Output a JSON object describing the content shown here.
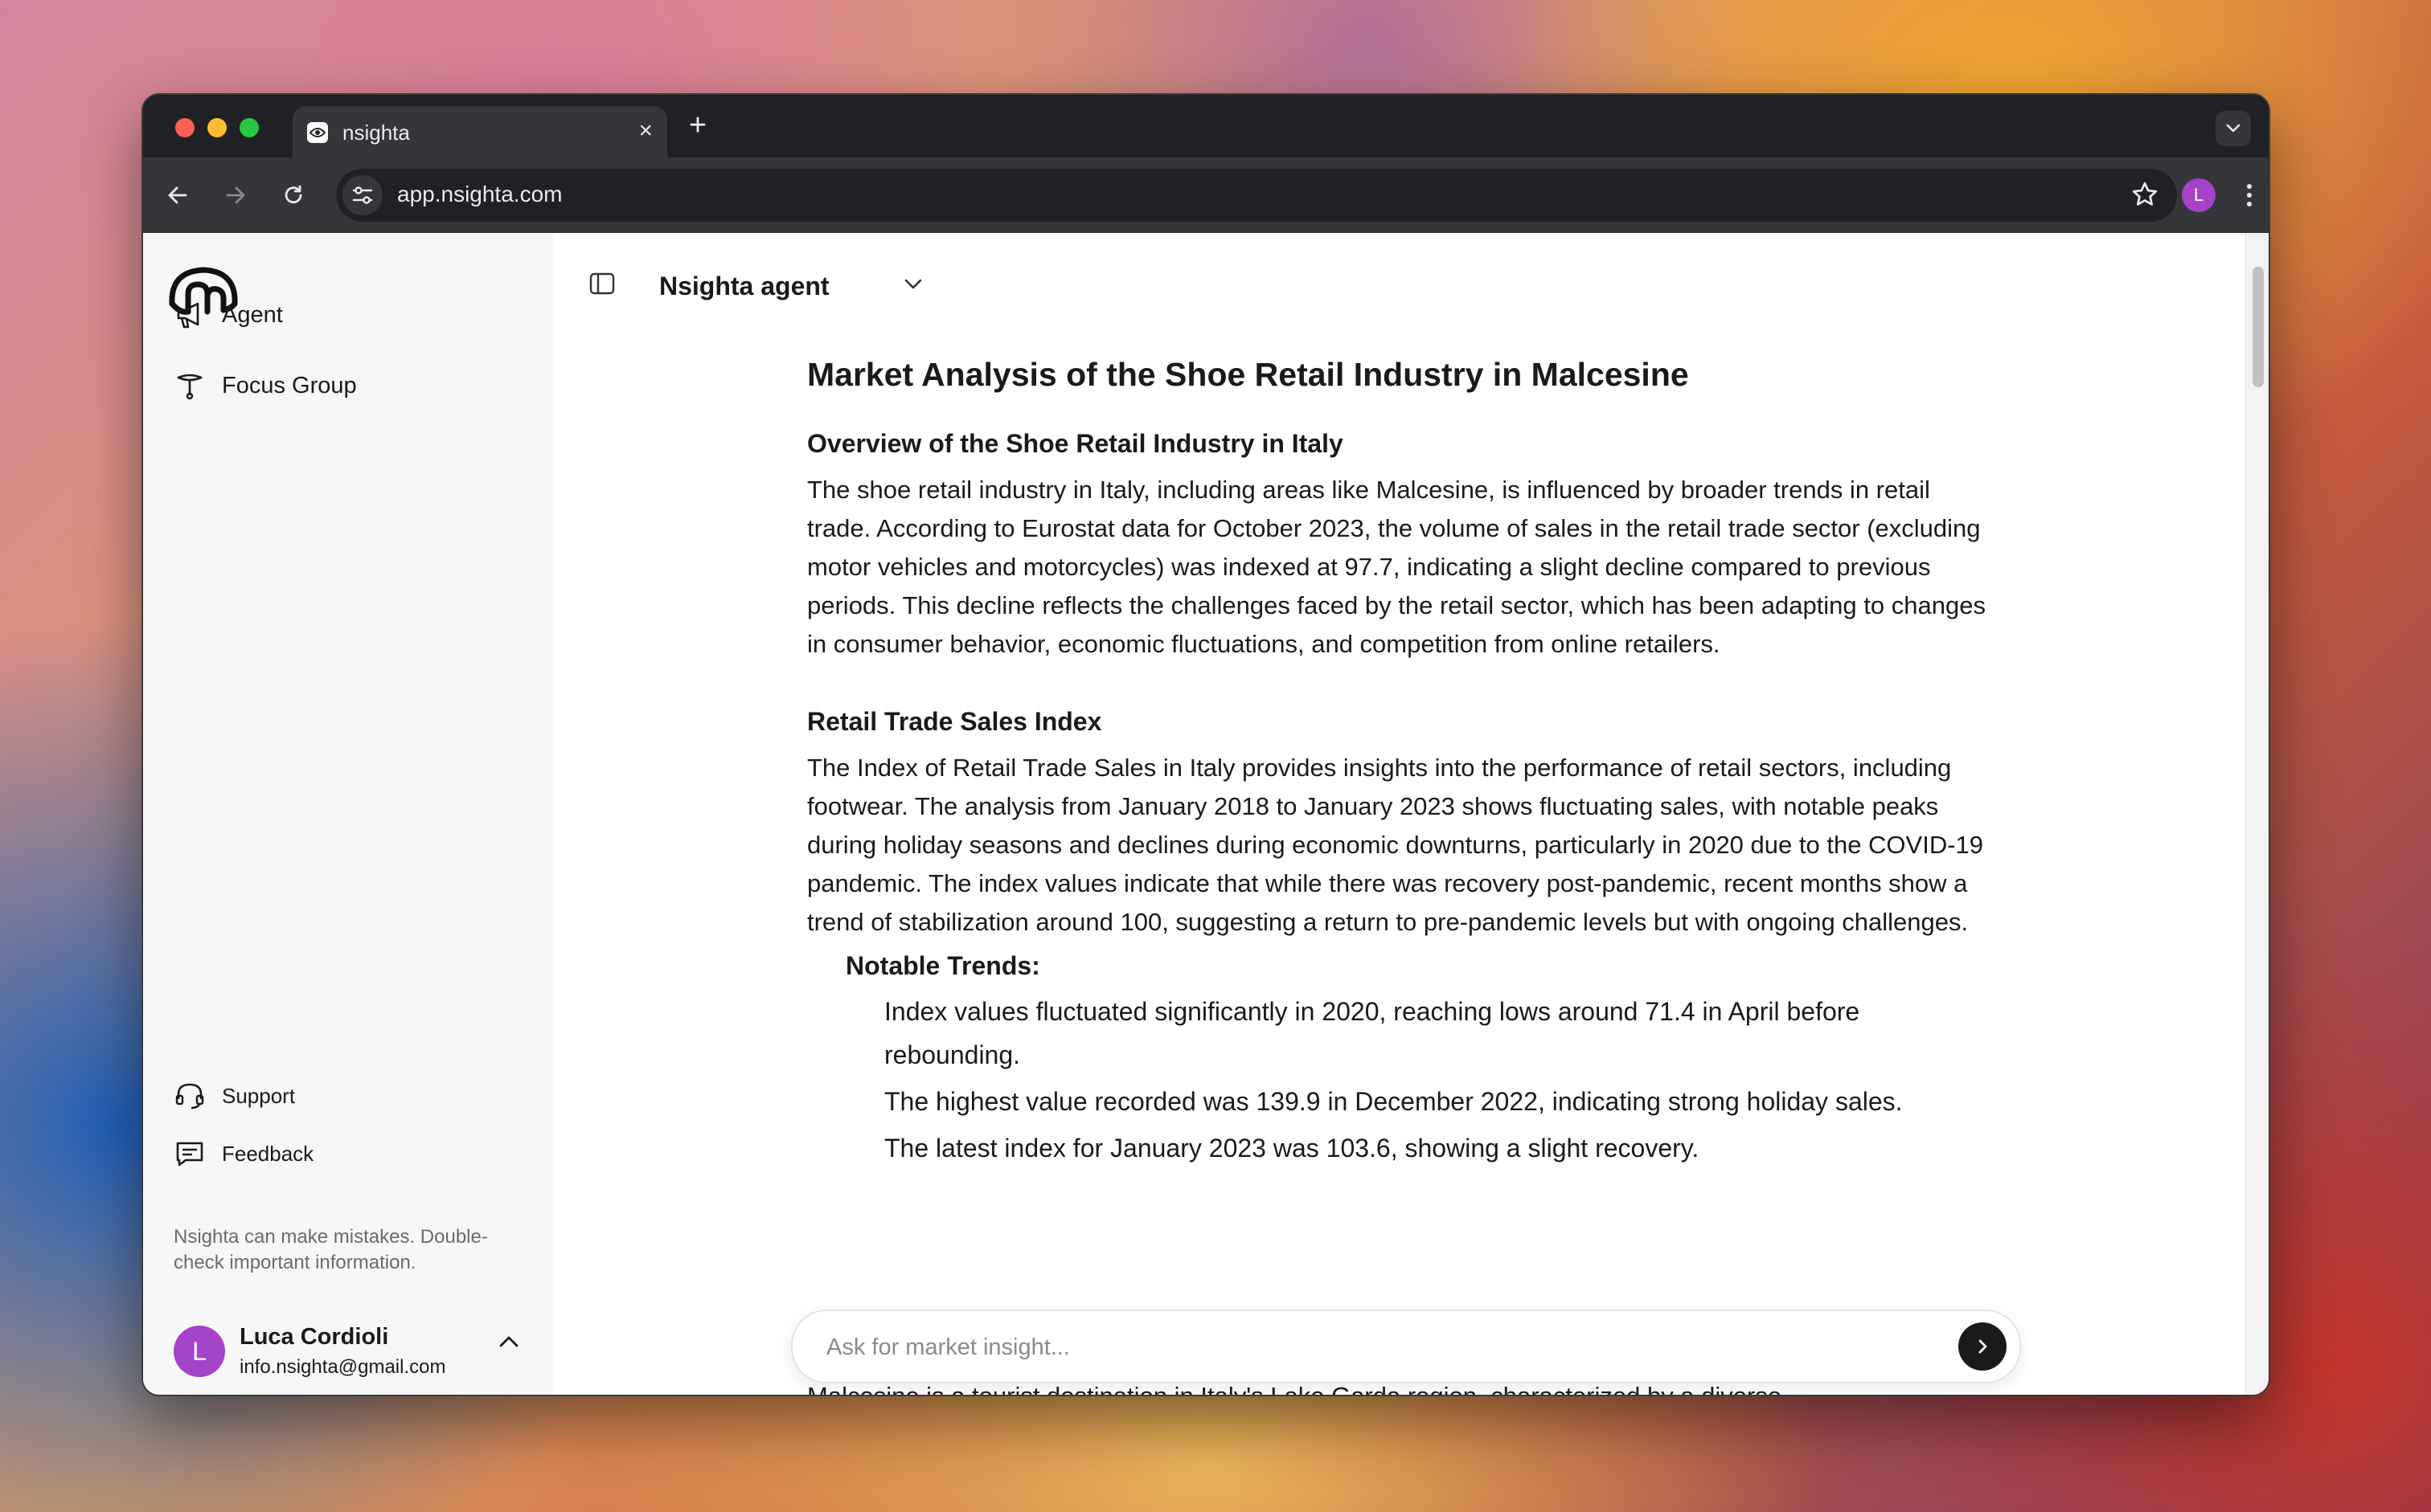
{
  "browser": {
    "tab_title": "nsighta",
    "tab_close": "×",
    "new_tab": "+",
    "url": "app.nsighta.com",
    "profile_initial": "L"
  },
  "sidebar": {
    "items": [
      {
        "label": "Agent"
      },
      {
        "label": "Focus Group"
      }
    ],
    "bottom_items": [
      {
        "label": "Support"
      },
      {
        "label": "Feedback"
      }
    ],
    "disclaimer": "Nsighta can make mistakes. Double-check important information.",
    "user": {
      "initial": "L",
      "name": "Luca Cordioli",
      "email": "info.nsighta@gmail.com"
    }
  },
  "header": {
    "title": "Nsighta agent"
  },
  "article": {
    "title": "Market Analysis of the Shoe Retail Industry in Malcesine",
    "section1_heading": "Overview of the Shoe Retail Industry in Italy",
    "section1_body": "The shoe retail industry in Italy, including areas like Malcesine, is influenced by broader trends in retail trade. According to Eurostat data for October 2023, the volume of sales in the retail trade sector (excluding motor vehicles and motorcycles) was indexed at 97.7, indicating a slight decline compared to previous periods. This decline reflects the challenges faced by the retail sector, which has been adapting to changes in consumer behavior, economic fluctuations, and competition from online retailers.",
    "section2_heading": "Retail Trade Sales Index",
    "section2_body": "The Index of Retail Trade Sales in Italy provides insights into the performance of retail sectors, including footwear. The analysis from January 2018 to January 2023 shows fluctuating sales, with notable peaks during holiday seasons and declines during economic downturns, particularly in 2020 due to the COVID-19 pandemic. The index values indicate that while there was recovery post-pandemic, recent months show a trend of stabilization around 100, suggesting a return to pre-pandemic levels but with ongoing challenges.",
    "trends_heading": "Notable Trends:",
    "trends": [
      "Index values fluctuated significantly in 2020, reaching lows around 71.4 in April before rebounding.",
      "The highest value recorded was 139.9 in December 2022, indicating strong holiday sales.",
      "The latest index for January 2023 was 103.6, showing a slight recovery."
    ],
    "next_paragraph_start": "Malcesine is a tourist destination in Italy's Lake Garda region, characterized by a diverse"
  },
  "composer": {
    "placeholder": "Ask for market insight..."
  }
}
